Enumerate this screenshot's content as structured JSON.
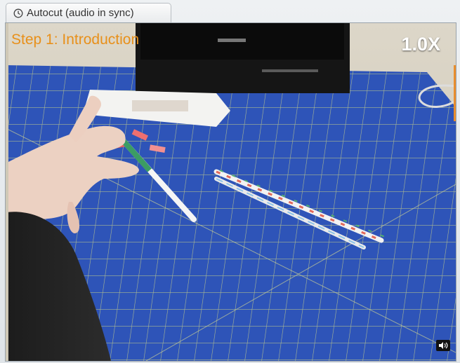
{
  "tab": {
    "label": "Autocut (audio in sync)",
    "icon": "clock-icon"
  },
  "video": {
    "step_title": "Step 1: Introduction",
    "speed": "1.0X",
    "volume_icon": "speaker-icon"
  },
  "colors": {
    "step_title": "#e8901a",
    "mat_blue": "#2e54b8",
    "grid_line": "#c8cf8a"
  }
}
